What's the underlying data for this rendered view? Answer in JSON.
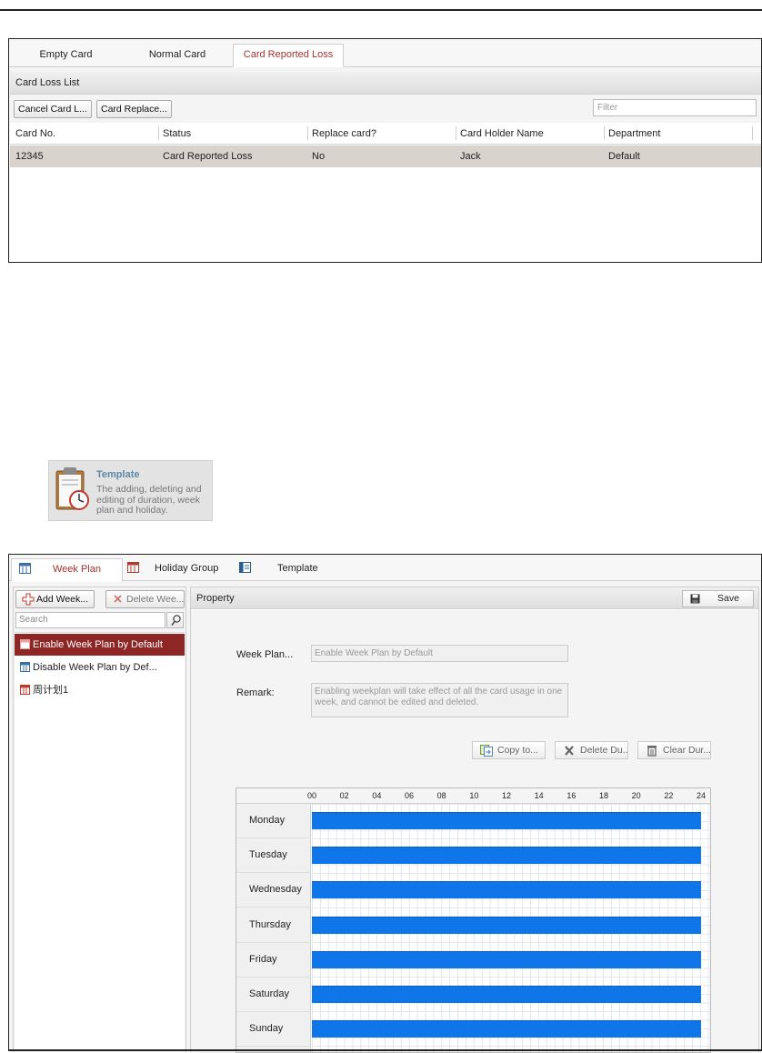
{
  "card_panel": {
    "tabs": [
      {
        "label": "Empty Card",
        "active": false
      },
      {
        "label": "Normal Card",
        "active": false
      },
      {
        "label": "Card Reported Loss",
        "active": true
      }
    ],
    "section_title": "Card Loss List",
    "buttons": {
      "cancel": "Cancel Card L...",
      "replace": "Card Replace..."
    },
    "filter_placeholder": "Filter",
    "columns": [
      "Card No.",
      "Status",
      "Replace card?",
      "Card Holder Name",
      "Department"
    ],
    "rows": [
      [
        "12345",
        "Card Reported Loss",
        "No",
        "Jack",
        "Default"
      ]
    ]
  },
  "template_tile": {
    "title": "Template",
    "description": "The adding, deleting and editing of duration, week plan and holiday."
  },
  "schedule_panel": {
    "tabs": [
      {
        "label": "Week Plan",
        "active": true,
        "icon": "calendar-icon"
      },
      {
        "label": "Holiday Group",
        "active": false,
        "icon": "calendar-icon"
      },
      {
        "label": "Template",
        "active": false,
        "icon": "template-icon"
      }
    ],
    "left": {
      "add_button": "Add Week...",
      "delete_button": "Delete Wee...",
      "search_placeholder": "Search",
      "plans": [
        {
          "label": "Enable Week Plan by Default",
          "selected": true
        },
        {
          "label": "Disable Week Plan by Def...",
          "selected": false
        },
        {
          "label": "周计划1",
          "selected": false
        }
      ]
    },
    "property": {
      "header": "Property",
      "save_button": "Save",
      "week_plan_label": "Week Plan...",
      "week_plan_value": "Enable Week Plan by Default",
      "remark_label": "Remark:",
      "remark_value": "Enabling weekplan will take effect of all the card usage in one week, and cannot be edited and deleted.",
      "copy_button": "Copy to...",
      "delete_button": "Delete Du...",
      "clear_button": "Clear Dur...",
      "hours": [
        "00",
        "02",
        "04",
        "06",
        "08",
        "10",
        "12",
        "14",
        "16",
        "18",
        "20",
        "22",
        "24"
      ],
      "days": [
        "Monday",
        "Tuesday",
        "Wednesday",
        "Thursday",
        "Friday",
        "Saturday",
        "Sunday"
      ],
      "durations": [
        {
          "day": "Monday",
          "start": 0,
          "end": 24
        },
        {
          "day": "Tuesday",
          "start": 0,
          "end": 24
        },
        {
          "day": "Wednesday",
          "start": 0,
          "end": 24
        },
        {
          "day": "Thursday",
          "start": 0,
          "end": 24
        },
        {
          "day": "Friday",
          "start": 0,
          "end": 24
        },
        {
          "day": "Saturday",
          "start": 0,
          "end": 24
        },
        {
          "day": "Sunday",
          "start": 0,
          "end": 24
        }
      ]
    }
  },
  "colors": {
    "accent_red": "#a8302e",
    "selected_row": "#8e2626",
    "duration_blue": "#0e76e8"
  }
}
